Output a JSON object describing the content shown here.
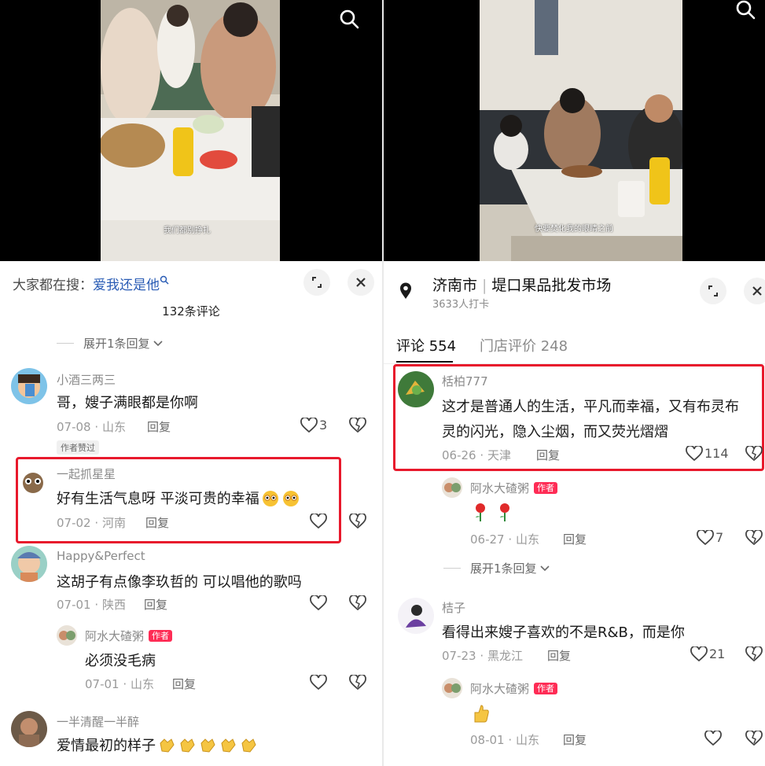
{
  "left": {
    "video": {
      "caption": "我们都别挣扎"
    },
    "search_bar": {
      "prefix": "大家都在搜：",
      "term": "爱我还是他"
    },
    "comment_count": "132条评论",
    "expand_top": "展开1条回复",
    "comments": [
      {
        "user": "小酒三两三",
        "text": "哥，嫂子满眼都是你啊",
        "date": "07-08",
        "location": "山东",
        "reply": "回复",
        "likes": "3",
        "badge": "作者赞过"
      },
      {
        "user": "一起抓星星",
        "text": "好有生活气息呀 平淡可贵的幸福",
        "date": "07-02",
        "location": "河南",
        "reply": "回复"
      },
      {
        "user": "Happy&Perfect",
        "text": "这胡子有点像李玖哲的 可以唱他的歌吗",
        "date": "07-01",
        "location": "陕西",
        "reply": "回复"
      }
    ],
    "author_reply": {
      "user": "阿水大碴粥",
      "tag": "作者",
      "text": "必须没毛病",
      "date": "07-01",
      "location": "山东",
      "reply": "回复"
    },
    "last_comment": {
      "user": "一半清醒一半醉",
      "text": "爱情最初的样子"
    }
  },
  "right": {
    "video": {
      "caption": "快要焚化我的眼睛之前"
    },
    "location": {
      "city": "济南市",
      "place": "堤口果品批发市场",
      "checkins": "3633人打卡"
    },
    "tabs": [
      {
        "label": "评论 554"
      },
      {
        "label": "门店评价 248"
      }
    ],
    "comments": [
      {
        "user": "栝柏777",
        "text1": "这才是普通人的生活，平凡而幸福，又有布灵布",
        "text2": "灵的闪光，隐入尘烟，而又荧光熠熠",
        "date": "06-26",
        "location": "天津",
        "reply": "回复",
        "likes": "114"
      },
      {
        "user": "桔子",
        "text": "看得出来嫂子喜欢的不是R&B，而是你",
        "date": "07-23",
        "location": "黑龙江",
        "reply": "回复",
        "likes": "21"
      }
    ],
    "author_reply_1": {
      "user": "阿水大碴粥",
      "tag": "作者",
      "date": "06-27",
      "location": "山东",
      "reply": "回复",
      "likes": "7"
    },
    "expand": "展开1条回复",
    "author_reply_2": {
      "user": "阿水大碴粥",
      "tag": "作者",
      "date": "08-01",
      "location": "山东",
      "reply": "回复"
    }
  },
  "sep": "·",
  "colors": {
    "accent_red": "#e8192c",
    "author_tag": "#fe2c55",
    "search_term": "#2b5db5"
  }
}
